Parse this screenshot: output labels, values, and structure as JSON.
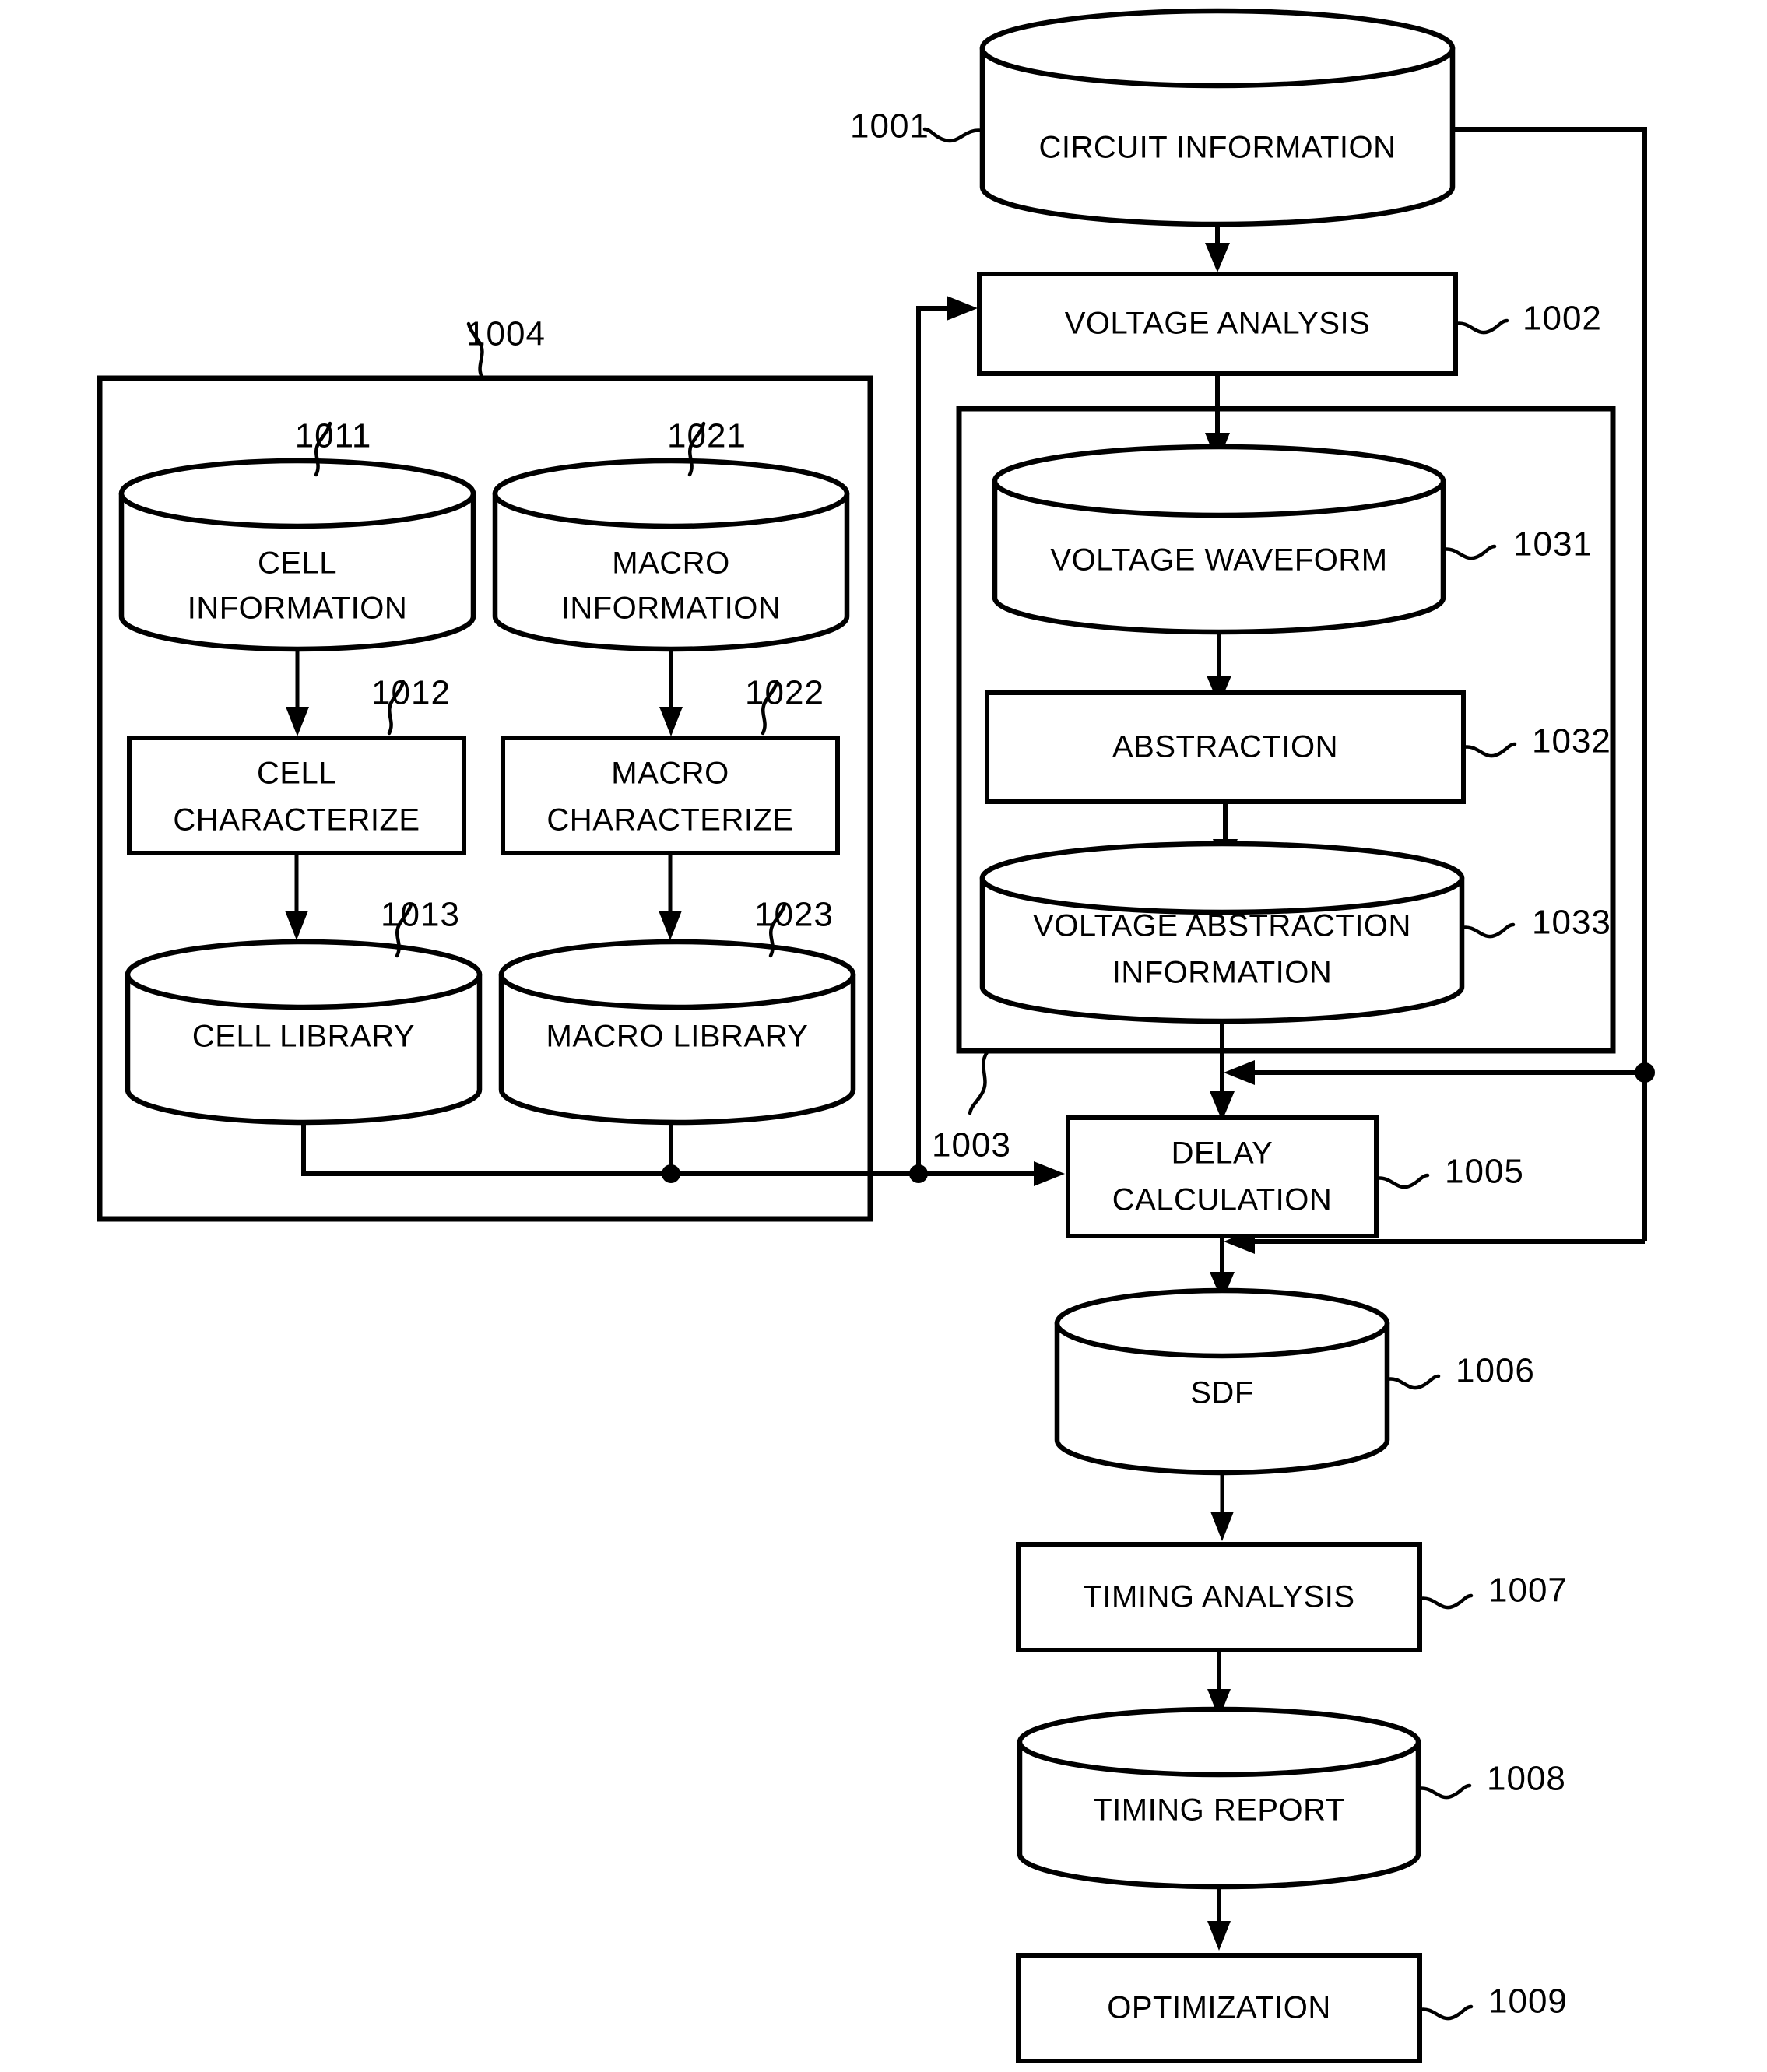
{
  "figure": {
    "type": "flowchart",
    "title": "",
    "background_color": "#ffffff",
    "line_color": "#000000"
  },
  "nodes": {
    "n1001": {
      "label": "CIRCUIT INFORMATION",
      "ref": "1001",
      "shape": "cylinder"
    },
    "n1002": {
      "label": "VOLTAGE ANALYSIS",
      "ref": "1002",
      "shape": "process"
    },
    "n1003": {
      "label": "",
      "ref": "1003",
      "shape": "group"
    },
    "n1004": {
      "label": "",
      "ref": "1004",
      "shape": "group"
    },
    "n1005": {
      "label_line1": "DELAY",
      "label_line2": "CALCULATION",
      "ref": "1005",
      "shape": "process"
    },
    "n1006": {
      "label": "SDF",
      "ref": "1006",
      "shape": "cylinder"
    },
    "n1007": {
      "label": "TIMING ANALYSIS",
      "ref": "1007",
      "shape": "process"
    },
    "n1008": {
      "label": "TIMING REPORT",
      "ref": "1008",
      "shape": "cylinder"
    },
    "n1009": {
      "label": "OPTIMIZATION",
      "ref": "1009",
      "shape": "process"
    },
    "n1011": {
      "label_line1": "CELL",
      "label_line2": "INFORMATION",
      "ref": "1011",
      "shape": "cylinder"
    },
    "n1012": {
      "label_line1": "CELL",
      "label_line2": "CHARACTERIZE",
      "ref": "1012",
      "shape": "process"
    },
    "n1013": {
      "label": "CELL LIBRARY",
      "ref": "1013",
      "shape": "cylinder"
    },
    "n1021": {
      "label_line1": "MACRO",
      "label_line2": "INFORMATION",
      "ref": "1021",
      "shape": "cylinder"
    },
    "n1022": {
      "label_line1": "MACRO",
      "label_line2": "CHARACTERIZE",
      "ref": "1022",
      "shape": "process"
    },
    "n1023": {
      "label": "MACRO LIBRARY",
      "ref": "1023",
      "shape": "cylinder"
    },
    "n1031": {
      "label": "VOLTAGE WAVEFORM",
      "ref": "1031",
      "shape": "cylinder"
    },
    "n1032": {
      "label": "ABSTRACTION",
      "ref": "1032",
      "shape": "process"
    },
    "n1033": {
      "label_line1": "VOLTAGE ABSTRACTION",
      "label_line2": "INFORMATION",
      "ref": "1033",
      "shape": "cylinder"
    }
  },
  "reference_numerals": [
    "1001",
    "1002",
    "1003",
    "1004",
    "1005",
    "1006",
    "1007",
    "1008",
    "1009",
    "1011",
    "1012",
    "1013",
    "1021",
    "1022",
    "1023",
    "1031",
    "1032",
    "1033"
  ]
}
